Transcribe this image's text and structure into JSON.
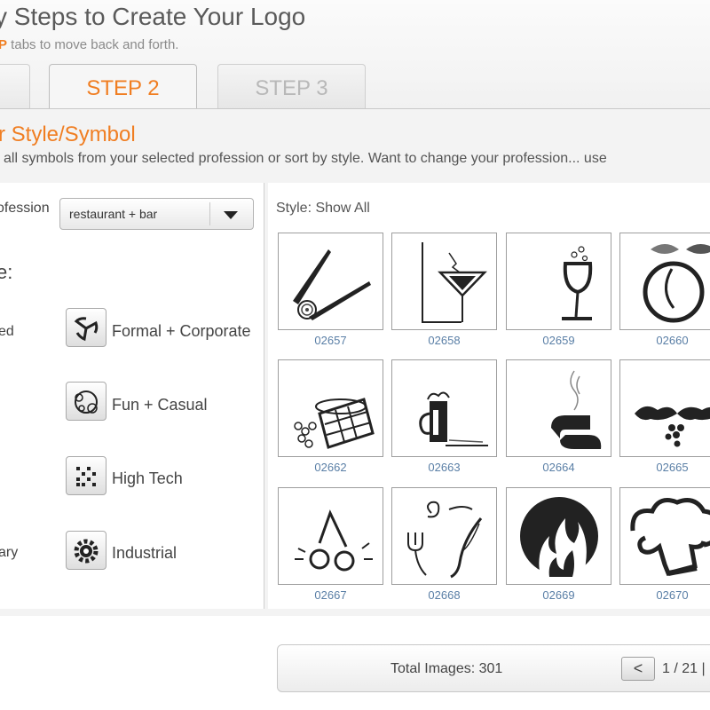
{
  "header": {
    "title": "y Steps to Create Your Logo",
    "subtitle_highlight": "P",
    "subtitle_rest": " tabs to move back and forth."
  },
  "tabs": [
    {
      "label": ""
    },
    {
      "label": "STEP 2"
    },
    {
      "label": "STEP 3"
    }
  ],
  "section": {
    "title": "r Style/Symbol",
    "description": "all symbols from your selected profession or sort by style. Want to change your profession... use"
  },
  "left_panel": {
    "profession_label": "ofession",
    "profession_value": "restaurant + bar",
    "style_heading": "e:",
    "cut_labels": [
      "ed",
      "ary"
    ],
    "styles": [
      {
        "label": "Formal + Corporate",
        "icon": "swirl-icon"
      },
      {
        "label": "Fun + Casual",
        "icon": "bubbles-icon"
      },
      {
        "label": "High Tech",
        "icon": "pixel-dots-icon"
      },
      {
        "label": "Industrial",
        "icon": "gear-icon"
      }
    ]
  },
  "gallery": {
    "style_filter": "Style:  Show All",
    "items": [
      {
        "id": "02657",
        "icon": "chopsticks-sushi-icon"
      },
      {
        "id": "02658",
        "icon": "martini-glass-icon"
      },
      {
        "id": "02659",
        "icon": "wine-glass-bubbles-icon"
      },
      {
        "id": "02660",
        "icon": "peach-fruit-icon"
      },
      {
        "id": "02662",
        "icon": "basket-grapes-icon"
      },
      {
        "id": "02663",
        "icon": "beer-mug-icon"
      },
      {
        "id": "02664",
        "icon": "steaming-cup-icon"
      },
      {
        "id": "02665",
        "icon": "grapes-leaves-icon"
      },
      {
        "id": "02667",
        "icon": "cherries-icon"
      },
      {
        "id": "02668",
        "icon": "fork-knife-swirl-icon"
      },
      {
        "id": "02669",
        "icon": "flame-circle-icon"
      },
      {
        "id": "02670",
        "icon": "chef-hat-icon"
      }
    ]
  },
  "footer": {
    "total_images": "Total Images: 301",
    "prev_label": "<",
    "page_indicator": "1 / 21 |"
  },
  "colors": {
    "accent": "#f07e22",
    "id_text": "#5a7fa6"
  }
}
